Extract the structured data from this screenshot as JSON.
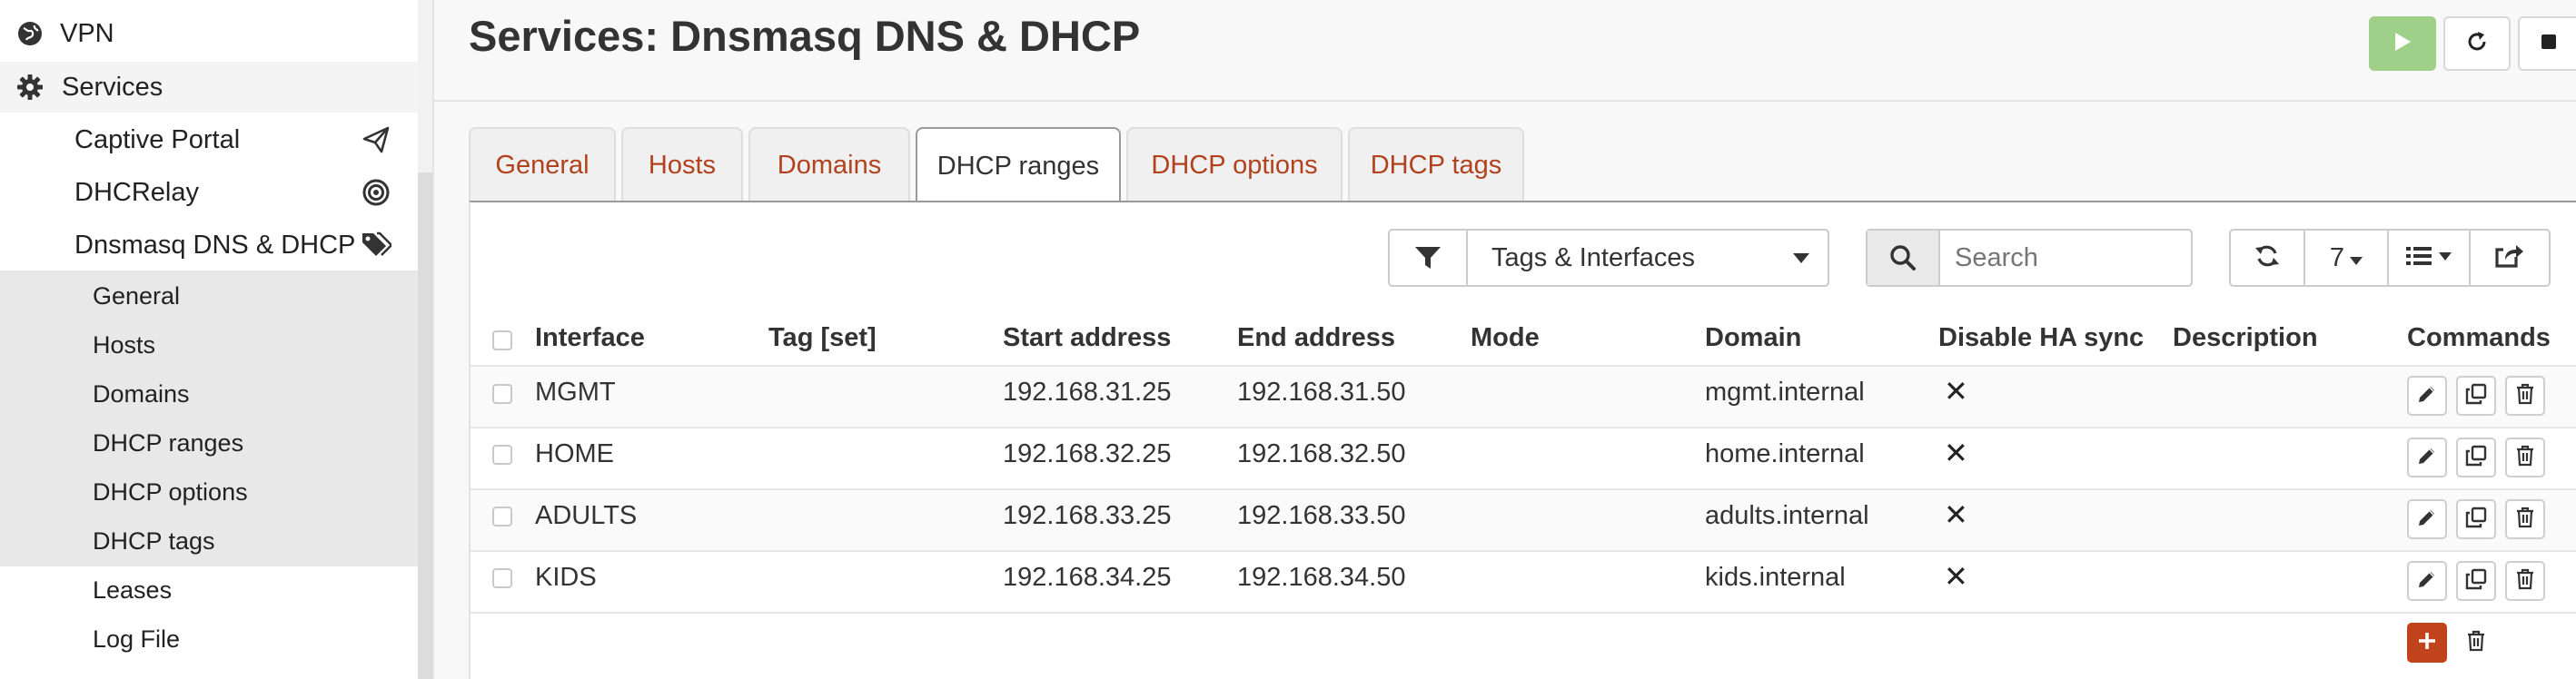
{
  "sidebar": {
    "vpn": "VPN",
    "services": "Services",
    "captive_portal": "Captive Portal",
    "dhcrelay": "DHCRelay",
    "dnsmasq": "Dnsmasq DNS & DHCP",
    "sub_items": [
      "General",
      "Hosts",
      "Domains",
      "DHCP ranges",
      "DHCP options",
      "DHCP tags",
      "Leases",
      "Log File"
    ]
  },
  "header": {
    "title": "Services: Dnsmasq DNS & DHCP"
  },
  "tabs": [
    "General",
    "Hosts",
    "Domains",
    "DHCP ranges",
    "DHCP options",
    "DHCP tags"
  ],
  "active_tab": "DHCP ranges",
  "toolbar": {
    "filter_value": "Tags & Interfaces",
    "search_placeholder": "Search",
    "rows_per_page": "7"
  },
  "table": {
    "columns": [
      "Interface",
      "Tag [set]",
      "Start address",
      "End address",
      "Mode",
      "Domain",
      "Disable HA sync",
      "Description",
      "Commands"
    ],
    "rows": [
      {
        "interface": "MGMT",
        "tag": "",
        "start": "192.168.31.25",
        "end": "192.168.31.50",
        "mode": "",
        "domain": "mgmt.internal",
        "disable_ha": "✕",
        "description": ""
      },
      {
        "interface": "HOME",
        "tag": "",
        "start": "192.168.32.25",
        "end": "192.168.32.50",
        "mode": "",
        "domain": "home.internal",
        "disable_ha": "✕",
        "description": ""
      },
      {
        "interface": "ADULTS",
        "tag": "",
        "start": "192.168.33.25",
        "end": "192.168.33.50",
        "mode": "",
        "domain": "adults.internal",
        "disable_ha": "✕",
        "description": ""
      },
      {
        "interface": "KIDS",
        "tag": "",
        "start": "192.168.34.25",
        "end": "192.168.34.50",
        "mode": "",
        "domain": "kids.internal",
        "disable_ha": "✕",
        "description": ""
      }
    ]
  },
  "colors": {
    "accent": "#b2421e",
    "add_button": "#c0431b",
    "start_button": "#9fd08a",
    "active_submenu_bg": "#e8e8e8"
  },
  "icons": [
    "globe-icon",
    "gear-icon",
    "paper-plane-icon",
    "target-icon",
    "tags-icon",
    "play-icon",
    "reload-icon",
    "stop-icon",
    "filter-icon",
    "caret-down-icon",
    "search-icon",
    "refresh-icon",
    "list-icon",
    "export-icon",
    "pencil-icon",
    "copy-icon",
    "trash-icon",
    "plus-icon"
  ]
}
